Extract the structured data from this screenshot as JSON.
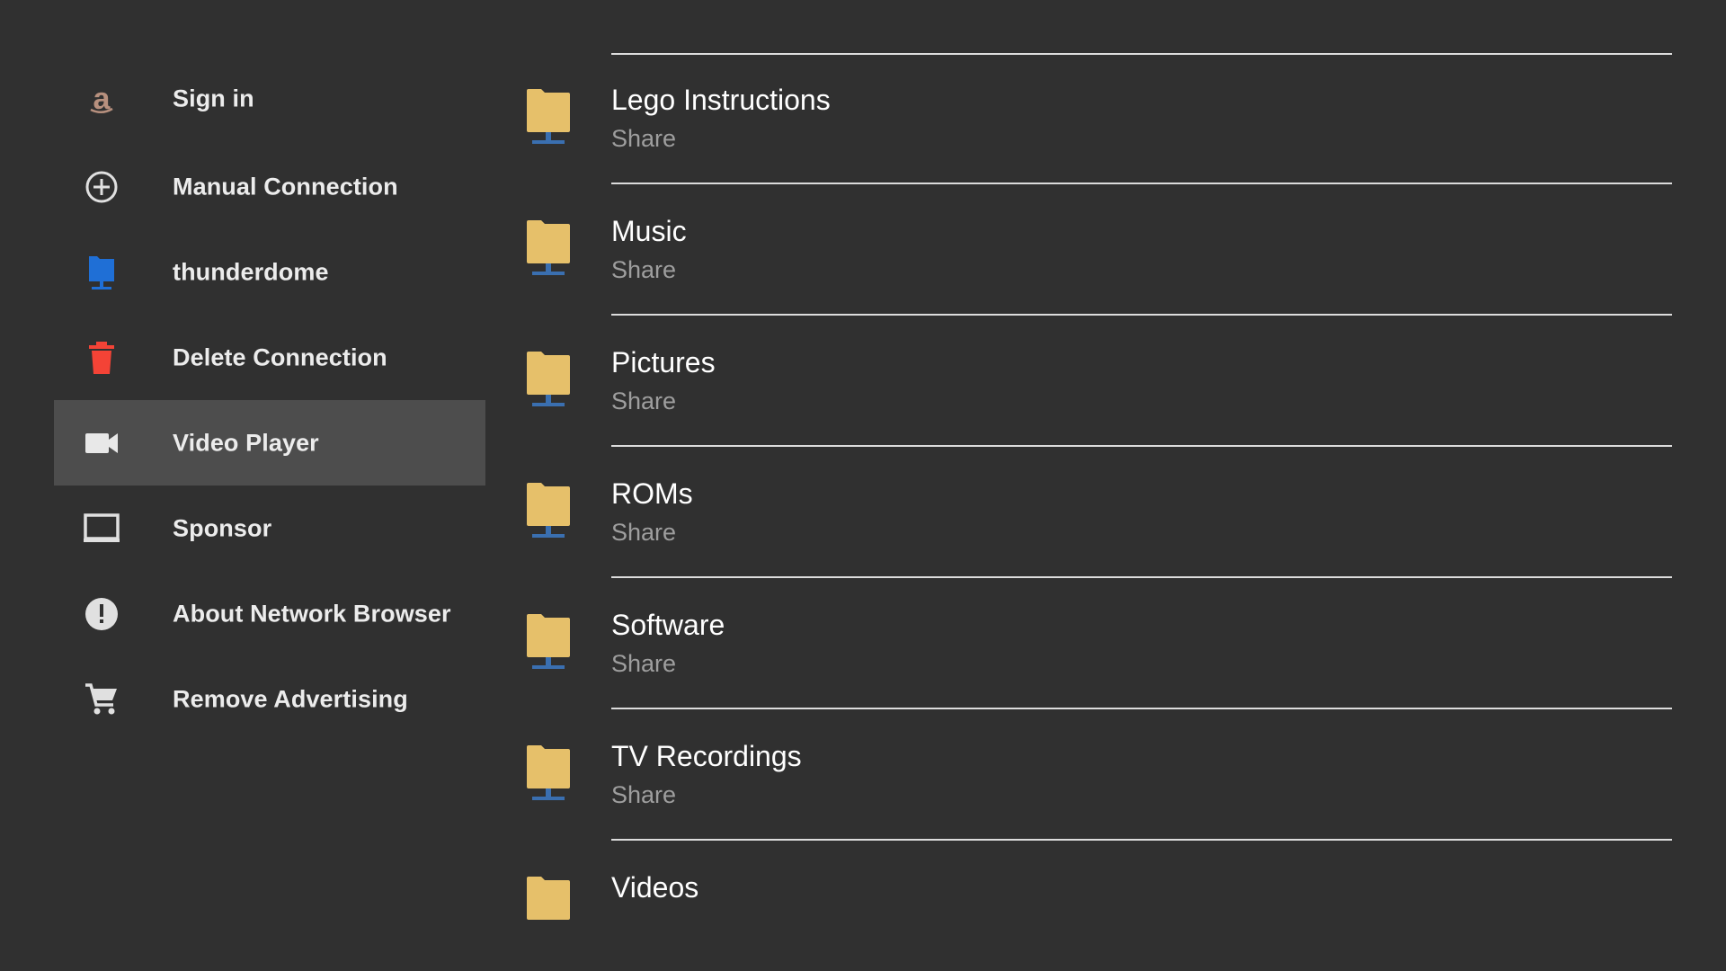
{
  "sidebar": {
    "items": [
      {
        "label": "Sign in",
        "icon": "amazon-icon"
      },
      {
        "label": "Manual Connection",
        "icon": "add-circle-icon"
      },
      {
        "label": "thunderdome",
        "icon": "network-folder-icon"
      },
      {
        "label": "Delete Connection",
        "icon": "trash-icon"
      },
      {
        "label": "Video Player",
        "icon": "video-camera-icon",
        "selected": true
      },
      {
        "label": "Sponsor",
        "icon": "monitor-icon"
      },
      {
        "label": "About Network Browser",
        "icon": "info-icon"
      },
      {
        "label": "Remove Advertising",
        "icon": "shopping-cart-icon"
      }
    ]
  },
  "shares": {
    "items": [
      {
        "name": "Lego Instructions",
        "type": "Share"
      },
      {
        "name": "Music",
        "type": "Share"
      },
      {
        "name": "Pictures",
        "type": "Share"
      },
      {
        "name": "ROMs",
        "type": "Share"
      },
      {
        "name": "Software",
        "type": "Share"
      },
      {
        "name": "TV Recordings",
        "type": "Share"
      },
      {
        "name": "Videos",
        "type": ""
      }
    ]
  },
  "colors": {
    "background": "#303030",
    "selected_item": "#4d4d4d",
    "folder": "#e6c06a",
    "network_stand": "#3a6fb0",
    "delete_red": "#f44336",
    "thunderdome_blue": "#1f6fd6",
    "amazon_brown": "#b7907e"
  }
}
